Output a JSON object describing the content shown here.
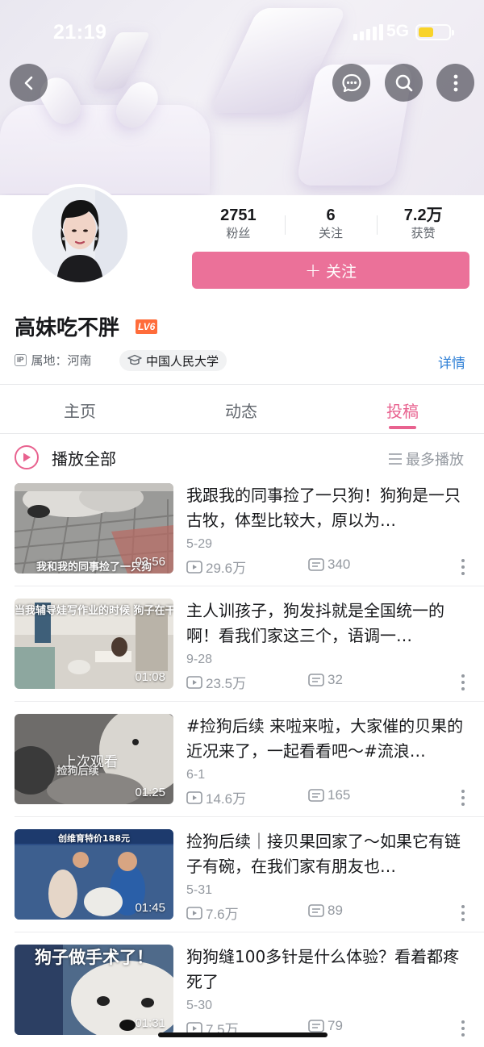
{
  "status": {
    "time": "21:19",
    "network": "5G"
  },
  "profile": {
    "stats": [
      {
        "value": "2751",
        "label": "粉丝"
      },
      {
        "value": "6",
        "label": "关注"
      },
      {
        "value": "7.2万",
        "label": "获赞"
      }
    ],
    "follow_label": "关注",
    "follow_plus": "+",
    "username": "高妹吃不胖",
    "level": "LV6",
    "ip_tag": "IP",
    "ip_location": "属地：河南",
    "school": "中国人民大学",
    "detail_link": "详情"
  },
  "tabs": [
    "主页",
    "动态",
    "投稿"
  ],
  "active_tab": "投稿",
  "playlist": {
    "play_all": "播放全部",
    "sort": "最多播放"
  },
  "videos": [
    {
      "title": "我跟我的同事捡了一只狗！狗狗是一只古牧，体型比较大，原以为…",
      "duration": "03:56",
      "date": "5-29",
      "views": "29.6万",
      "danmaku": "340",
      "caption": "我和我的同事捡了一只狗"
    },
    {
      "title": "主人训孩子，狗发抖就是全国统一的啊！看我们家这三个，语调一…",
      "duration": "01:08",
      "date": "9-28",
      "views": "23.5万",
      "danmaku": "32",
      "caption": "当我辅导娃写作业的时候 狗子在干嘛"
    },
    {
      "title": "#捡狗后续 来啦来啦，大家催的贝果的近况来了，一起看看吧～#流浪…",
      "duration": "01:25",
      "date": "6-1",
      "views": "14.6万",
      "danmaku": "165",
      "caption": "捡狗后续",
      "watched": "上次观看"
    },
    {
      "title": "捡狗后续｜接贝果回家了～如果它有链子有碗，在我们家有朋友也…",
      "duration": "01:45",
      "date": "5-31",
      "views": "7.6万",
      "danmaku": "89",
      "caption": "创维育特价188元"
    },
    {
      "title": "狗狗缝100多针是什么体验？看着都疼死了",
      "duration": "01:31",
      "date": "5-30",
      "views": "7.5万",
      "danmaku": "79",
      "caption": "狗子做手术了！"
    }
  ],
  "colors": {
    "accent": "#e8628f",
    "follow_button": "#eb7199",
    "link": "#2e7fd6",
    "level_badge": "#ff6c3a"
  },
  "icons": [
    "back-icon",
    "message-icon",
    "search-icon",
    "more-icon",
    "play-icon",
    "sort-icon",
    "views-icon",
    "danmaku-icon",
    "kebab-icon",
    "school-icon"
  ]
}
